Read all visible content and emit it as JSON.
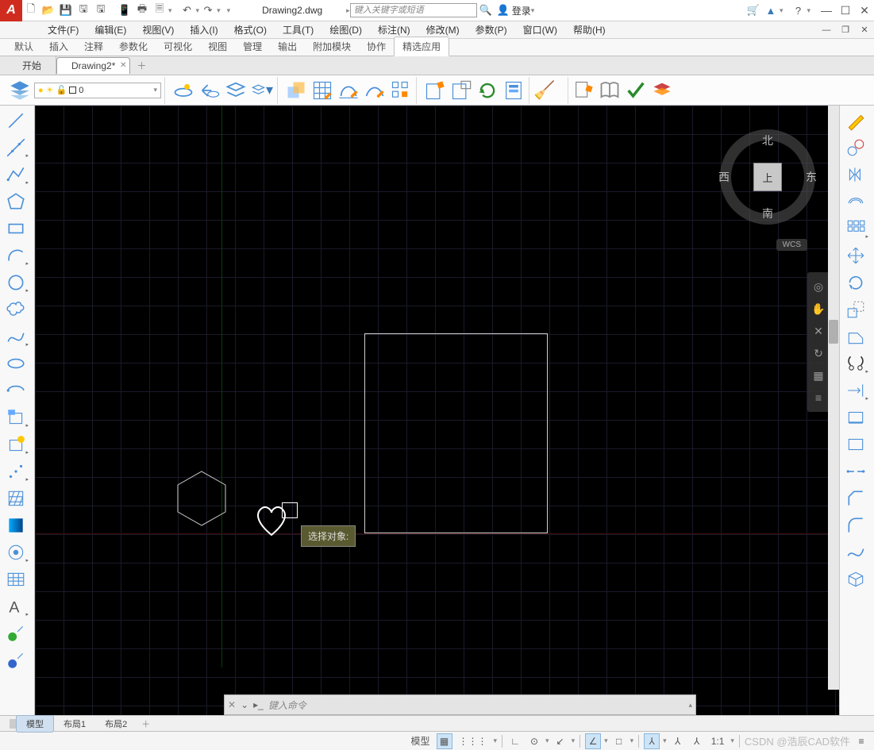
{
  "title": "Drawing2.dwg",
  "search_placeholder": "键入关键字或短语",
  "login_label": "登录",
  "menus": [
    "文件(F)",
    "编辑(E)",
    "视图(V)",
    "插入(I)",
    "格式(O)",
    "工具(T)",
    "绘图(D)",
    "标注(N)",
    "修改(M)",
    "参数(P)",
    "窗口(W)",
    "帮助(H)"
  ],
  "ribbon_tabs": [
    "默认",
    "插入",
    "注释",
    "参数化",
    "可视化",
    "视图",
    "管理",
    "输出",
    "附加模块",
    "协作",
    "精选应用"
  ],
  "ribbon_active": 10,
  "doc_tabs": [
    {
      "label": "开始",
      "active": false,
      "closable": false
    },
    {
      "label": "Drawing2*",
      "active": true,
      "closable": true
    }
  ],
  "layer": {
    "current_name": "0"
  },
  "viewcube": {
    "north": "北",
    "east": "东",
    "south": "南",
    "west": "西",
    "top": "上"
  },
  "wcs": "WCS",
  "tooltip_text": "选择对象:",
  "command_placeholder": "键入命令",
  "bottom_tabs": [
    {
      "label": "模型",
      "active": true
    },
    {
      "label": "布局1",
      "active": false
    },
    {
      "label": "布局2",
      "active": false
    }
  ],
  "status": {
    "model": "模型",
    "scale": "1:1"
  },
  "watermark": "CSDN @浩辰CAD软件",
  "left_tools": [
    "line",
    "line2",
    "polyline",
    "polygon",
    "rectangle",
    "arc",
    "circle",
    "cloud",
    "spline",
    "ellipse",
    "ellipse-arc",
    "block",
    "insert",
    "points",
    "hatch",
    "gradient",
    "region",
    "table",
    "text",
    "donut",
    "donut2"
  ],
  "right_tools": [
    "pencil",
    "copy",
    "mirror",
    "offset",
    "array",
    "move",
    "rotate",
    "scale",
    "stretch",
    "trim",
    "extend",
    "break",
    "break-point",
    "join",
    "chamfer",
    "fillet",
    "blend",
    "3d"
  ]
}
